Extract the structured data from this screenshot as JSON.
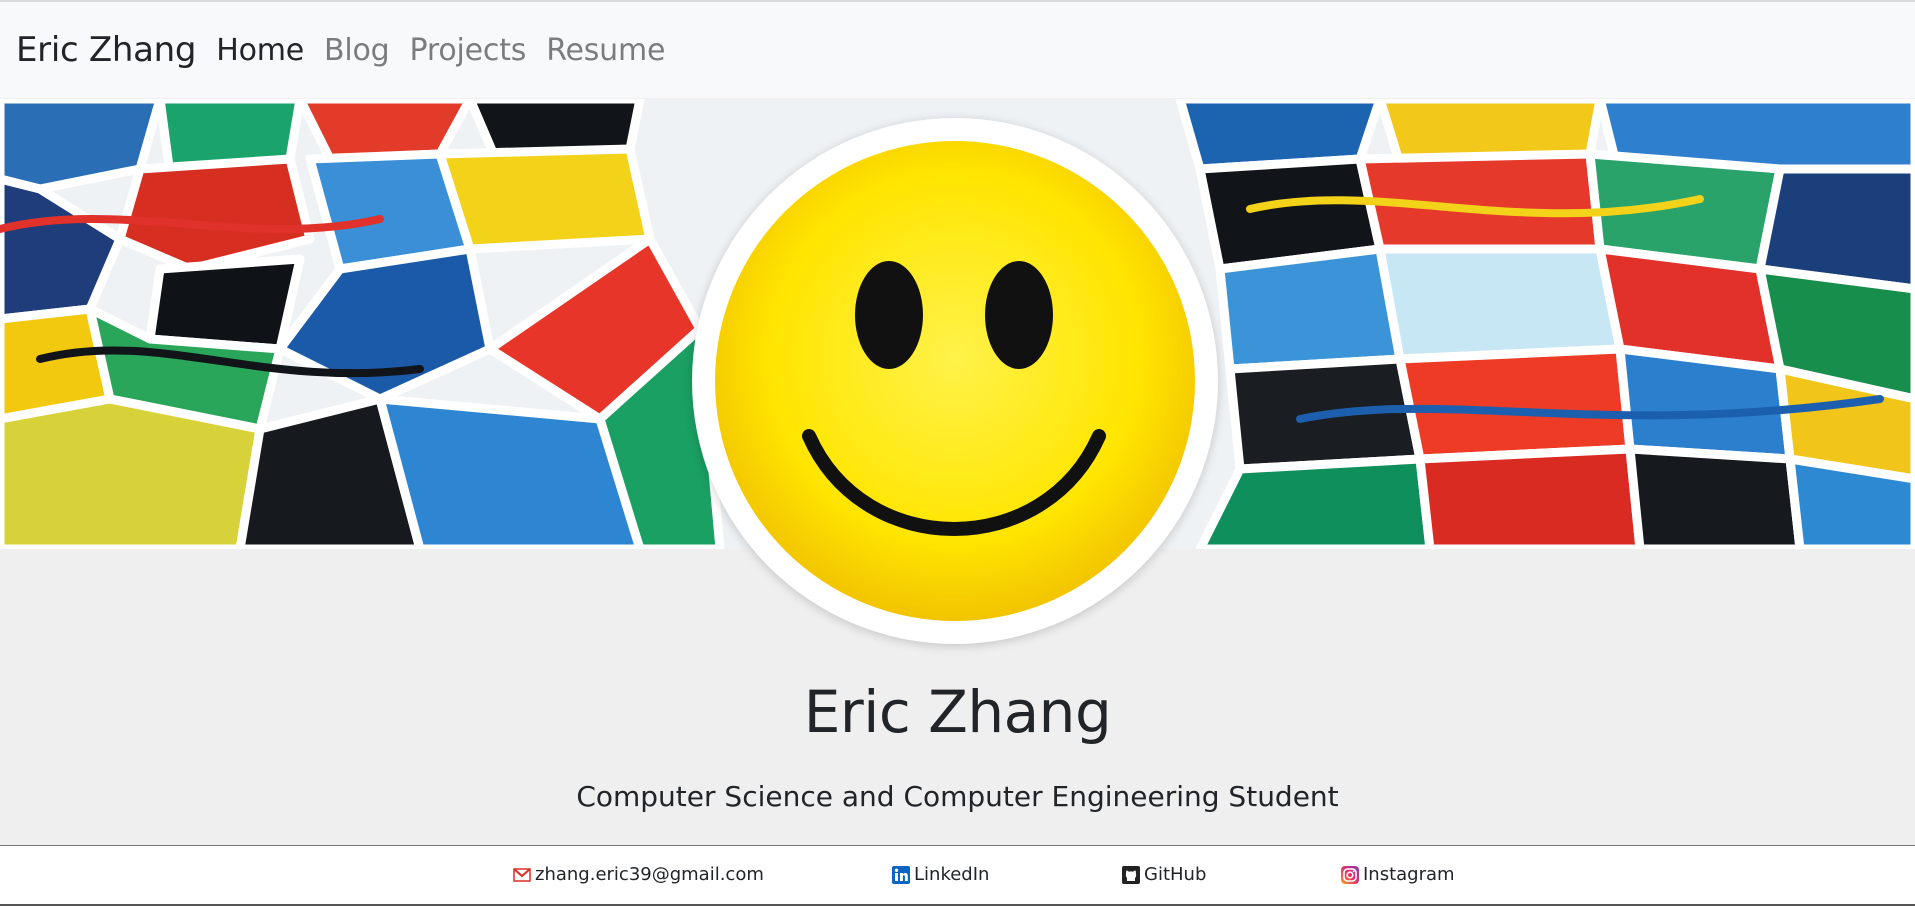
{
  "navbar": {
    "brand": "Eric Zhang",
    "links": [
      {
        "label": "Home",
        "active": true
      },
      {
        "label": "Blog",
        "active": false
      },
      {
        "label": "Projects",
        "active": false
      },
      {
        "label": "Resume",
        "active": false
      }
    ]
  },
  "banner": {
    "image": "colorful-abstract-painting"
  },
  "avatar": {
    "image": "yellow-smiley-face"
  },
  "hero": {
    "name": "Eric Zhang",
    "subtitle": "Computer Science and Computer Engineering Student"
  },
  "footer": {
    "links": [
      {
        "label": "zhang.eric39@gmail.com",
        "icon": "gmail-icon"
      },
      {
        "label": "LinkedIn",
        "icon": "linkedin-icon"
      },
      {
        "label": "GitHub",
        "icon": "github-icon"
      },
      {
        "label": "Instagram",
        "icon": "instagram-icon"
      }
    ]
  },
  "colors": {
    "navbar_bg": "#f8f9fa",
    "page_bg": "#efefef",
    "smiley_yellow": "#ffe500",
    "linkedin_blue": "#0a66c2",
    "gmail_red": "#d93025"
  }
}
